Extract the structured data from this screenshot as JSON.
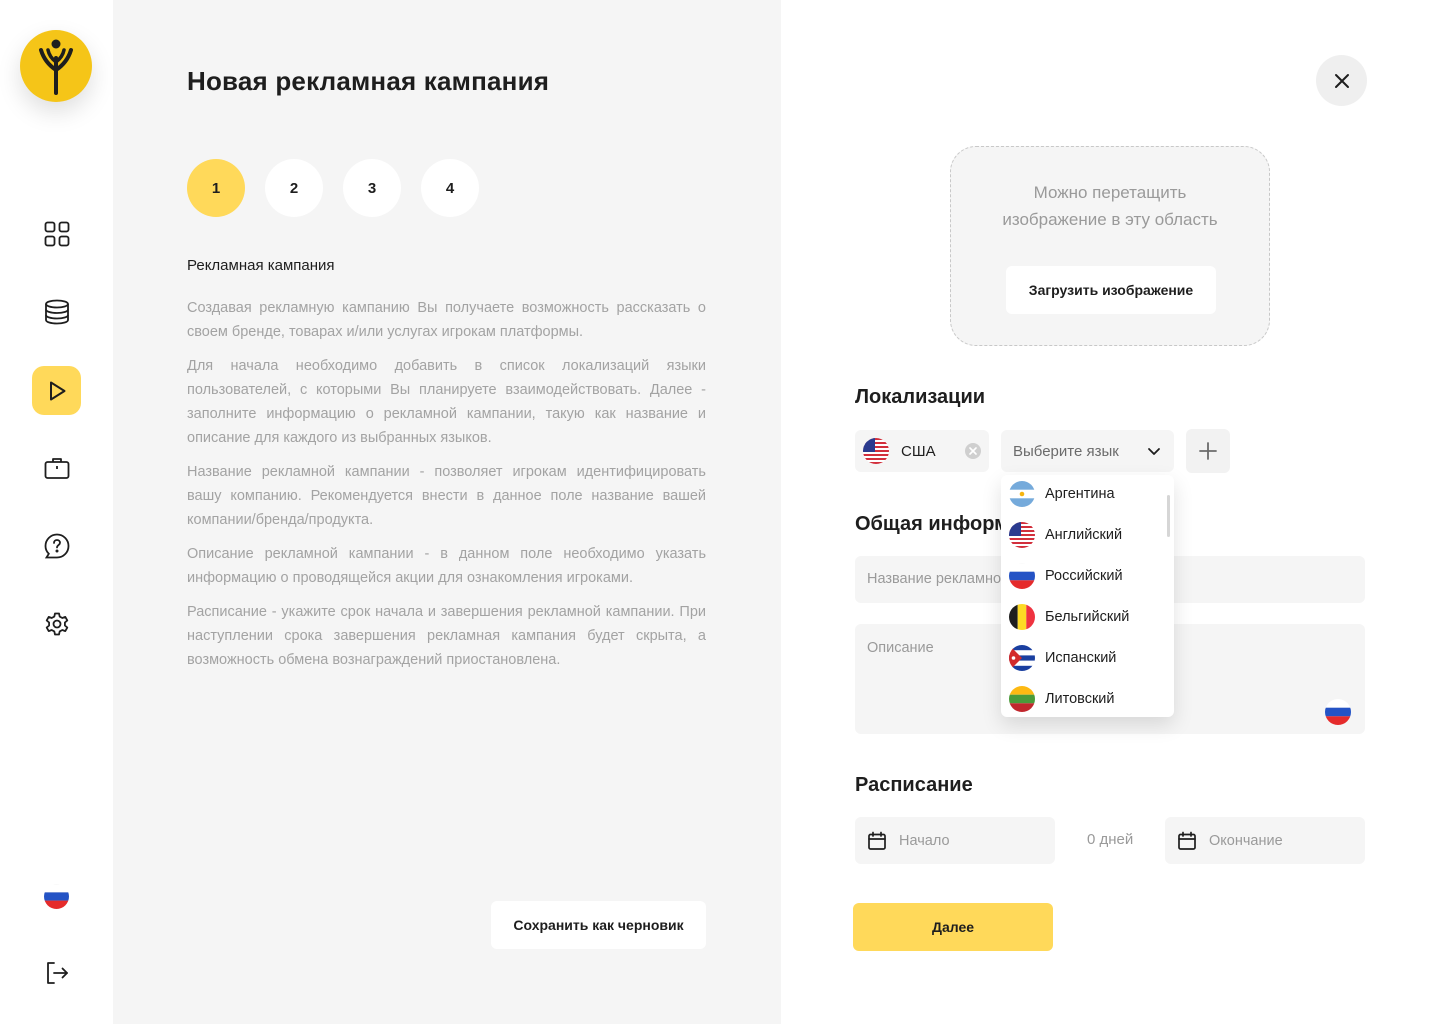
{
  "colors": {
    "accent": "#ffd95a",
    "logo": "#f5c518",
    "panel_bg": "#f5f5f5",
    "muted_text": "#a3a3a3"
  },
  "sidebar": {
    "logo_icon": "tree-y-logo",
    "items": [
      {
        "name": "dashboard",
        "icon": "grid-icon",
        "active": false
      },
      {
        "name": "database",
        "icon": "coins-stack-icon",
        "active": false
      },
      {
        "name": "campaigns",
        "icon": "play-icon",
        "active": true
      },
      {
        "name": "briefcase",
        "icon": "briefcase-icon",
        "active": false
      },
      {
        "name": "help",
        "icon": "help-chat-icon",
        "active": false
      },
      {
        "name": "settings",
        "icon": "gear-icon",
        "active": false
      }
    ],
    "language_flag": "flag-russia",
    "logout_icon": "logout-icon"
  },
  "info": {
    "title": "Новая рекламная кампания",
    "steps": [
      "1",
      "2",
      "3",
      "4"
    ],
    "active_step": "1",
    "section_title": "Рекламная кампания",
    "paragraphs": [
      "Создавая рекламную кампанию Вы получаете возможность рассказать о своем бренде, товарах и/или услугах игрокам платформы.",
      "Для начала необходимо добавить в список локализаций языки пользователей, с которыми Вы планируете взаимодействовать. Далее - заполните информацию о рекламной кампании, такую как название и описание для каждого из выбранных языков.",
      "Название рекламной кампании - позволяет игрокам идентифицировать вашу компанию. Рекомендуется внести в данное поле название вашей компании/бренда/продукта.",
      "Описание рекламной кампании - в данном поле необходимо указать информацию о проводящейся акции для ознакомления игроками.",
      "Расписание - укажите срок начала и завершения рекламной кампании. При наступлении срока завершения рекламная кампания будет скрыта, а возможность обмена вознаграждений приостановлена."
    ],
    "save_draft": "Сохранить как черновик"
  },
  "form": {
    "dropzone_text": "Можно перетащить изображение в эту область",
    "upload_button": "Загрузить изображение",
    "localizations_title": "Локализации",
    "selected_language": "США",
    "select_placeholder": "Выберите язык",
    "language_options": [
      "Аргентина",
      "Английский",
      "Российский",
      "Бельгийский",
      "Испанский",
      "Литовский"
    ],
    "general_title": "Общая информ",
    "name_placeholder": "Название рекламной",
    "description_placeholder": "Описание",
    "schedule_title": "Расписание",
    "start_placeholder": "Начало",
    "days_text": "0 дней",
    "end_placeholder": "Окончание",
    "next_button": "Далее"
  }
}
